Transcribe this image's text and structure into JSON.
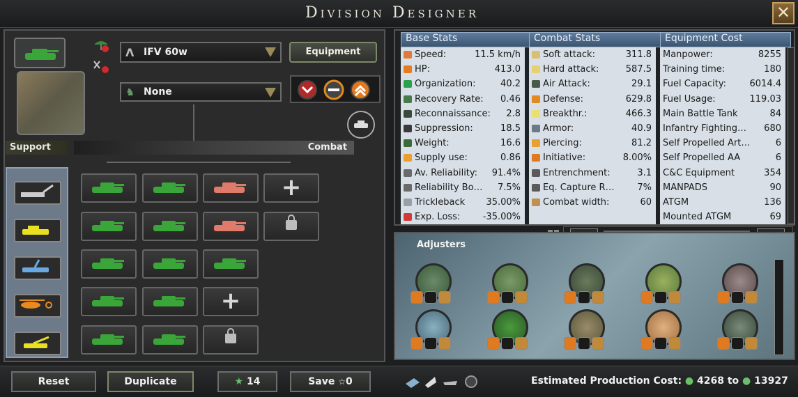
{
  "window": {
    "title": "Division Designer",
    "close_label": "✕"
  },
  "left": {
    "template_name": "IFV 60w",
    "equipment_button": "Equipment",
    "secondary_select": "None",
    "support_label": "Support",
    "combat_label": "Combat"
  },
  "base_stats": {
    "header": "Base Stats",
    "rows": [
      {
        "label": "Speed:",
        "value": "11.5 km/h",
        "color": "#e07a3a"
      },
      {
        "label": "HP:",
        "value": "413.0",
        "color": "#e87a20"
      },
      {
        "label": "Organization:",
        "value": "40.2",
        "color": "#2aa24a"
      },
      {
        "label": "Recovery Rate:",
        "value": "0.46",
        "color": "#4a7a4a"
      },
      {
        "label": "Reconnaissance:",
        "value": "2.8",
        "color": "#3a4a3a"
      },
      {
        "label": "Suppression:",
        "value": "18.5",
        "color": "#3a3a3a"
      },
      {
        "label": "Weight:",
        "value": "16.6",
        "color": "#3a6a3a"
      },
      {
        "label": "Supply use:",
        "value": "0.86",
        "color": "#e8a030"
      },
      {
        "label": "Av. Reliability:",
        "value": "91.4%",
        "color": "#6a6a6a"
      },
      {
        "label": "Reliability Bo…",
        "value": "7.5%",
        "color": "#6a6a6a"
      },
      {
        "label": "Trickleback",
        "value": "35.00%",
        "color": "#9aa0a6"
      },
      {
        "label": "Exp. Loss:",
        "value": "-35.00%",
        "color": "#d03a3a"
      }
    ]
  },
  "combat_stats": {
    "header": "Combat Stats",
    "rows": [
      {
        "label": "Soft attack:",
        "value": "311.8",
        "color": "#d8c070"
      },
      {
        "label": "Hard attack:",
        "value": "587.5",
        "color": "#e8d070"
      },
      {
        "label": "Air Attack:",
        "value": "29.1",
        "color": "#4a5a4a"
      },
      {
        "label": "Defense:",
        "value": "629.8",
        "color": "#e08a20"
      },
      {
        "label": "Breakthr.:",
        "value": "466.3",
        "color": "#e8e070"
      },
      {
        "label": "Armor:",
        "value": "40.9",
        "color": "#6a7a8a"
      },
      {
        "label": "Piercing:",
        "value": "81.2",
        "color": "#e8a030"
      },
      {
        "label": "Initiative:",
        "value": "8.00%",
        "color": "#e07a20"
      },
      {
        "label": "Entrenchment:",
        "value": "3.1",
        "color": "#5a5a5a"
      },
      {
        "label": "Eq. Capture R…",
        "value": "7%",
        "color": "#5a5a5a"
      },
      {
        "label": "Combat width:",
        "value": "60",
        "color": "#c09050"
      }
    ]
  },
  "equipment_cost": {
    "header": "Equipment Cost",
    "rows": [
      {
        "label": "Manpower:",
        "value": "8255"
      },
      {
        "label": "Training time:",
        "value": "180"
      },
      {
        "label": "Fuel Capacity:",
        "value": "6014.4"
      },
      {
        "label": "Fuel Usage:",
        "value": "119.03"
      },
      {
        "label": "Main Battle Tank",
        "value": "84"
      },
      {
        "label": "Infantry Fighting…",
        "value": "680"
      },
      {
        "label": "Self Propelled Art…",
        "value": "6"
      },
      {
        "label": "Self Propelled AA",
        "value": "6"
      },
      {
        "label": "C&C Equipment",
        "value": "354"
      },
      {
        "label": "MANPADS",
        "value": "90"
      },
      {
        "label": "ATGM",
        "value": "136"
      },
      {
        "label": "Mounted ATGM",
        "value": "69"
      }
    ]
  },
  "adjusters": {
    "title": "Adjusters"
  },
  "bottom": {
    "reset": "Reset",
    "duplicate": "Duplicate",
    "xp": "14",
    "save": "Save",
    "save_cost": "0",
    "est_label": "Estimated Production Cost:",
    "cost_low": "4268",
    "cost_to": "to",
    "cost_high": "13927"
  },
  "colors": {
    "tank_green": "#3aa63a",
    "tank_pink": "#e07a6a",
    "support_yellow": "#e8e020",
    "support_blue": "#6aa8e0",
    "support_orange": "#e88a20"
  }
}
